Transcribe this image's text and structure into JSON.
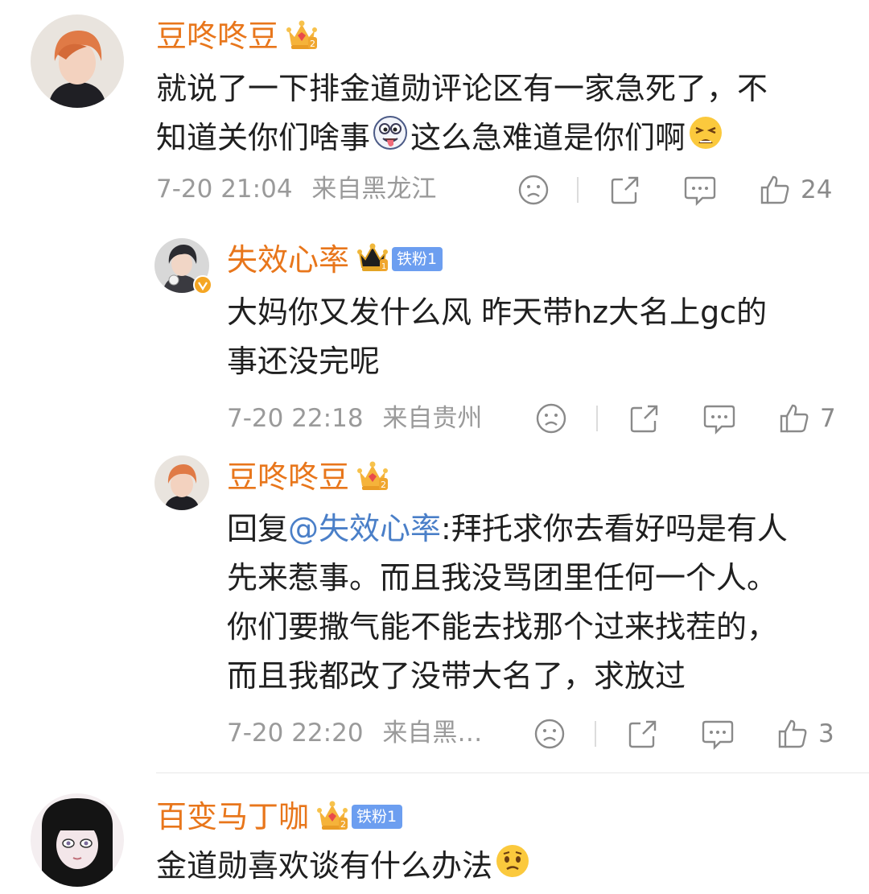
{
  "comments": [
    {
      "username": "豆咚咚豆",
      "text_lines": [
        "就说了一下排金道勋评论区有一家急死了，不",
        "知道关你们啥事",
        "这么急难道是你们啊"
      ],
      "emojis": [
        "ghost-tongue-emoji",
        "tired-face-emoji"
      ],
      "timestamp": "7-20 21:04",
      "location": "来自黑龙江",
      "likes": "24",
      "badges": [
        "crown-badge-2"
      ]
    },
    {
      "username": "失效心率",
      "fan_badge": "铁粉1",
      "text_lines": [
        "大妈你又发什么风  昨天带hz大名上gc的",
        "事还没完呢"
      ],
      "timestamp": "7-20 22:18",
      "location": "来自贵州",
      "likes": "7",
      "badges": [
        "crown-badge-black",
        "verified-badge"
      ]
    },
    {
      "username": "豆咚咚豆",
      "reply_prefix": "回复",
      "mention": "@失效心率",
      "text_lines": [
        ":拜托求你去看好吗是有人",
        "先来惹事。而且我没骂团里任何一个人。",
        "你们要撒气能不能去找那个过来找茬的，",
        "而且我都改了没带大名了，求放过"
      ],
      "timestamp": "7-20 22:20",
      "location": "来自黑…",
      "likes": "3",
      "badges": [
        "crown-badge-2"
      ]
    },
    {
      "username": "百变马丁咖",
      "fan_badge": "铁粉1",
      "text_lines": [
        "金道勋喜欢谈有什么办法"
      ],
      "emojis": [
        "worried-face-emoji"
      ],
      "badges": [
        "crown-badge-2"
      ]
    }
  ],
  "colors": {
    "username": "#e8761b",
    "mention": "#4a7fc8",
    "meta": "#9a9a9a",
    "fan_badge": "#6c9ef0"
  }
}
